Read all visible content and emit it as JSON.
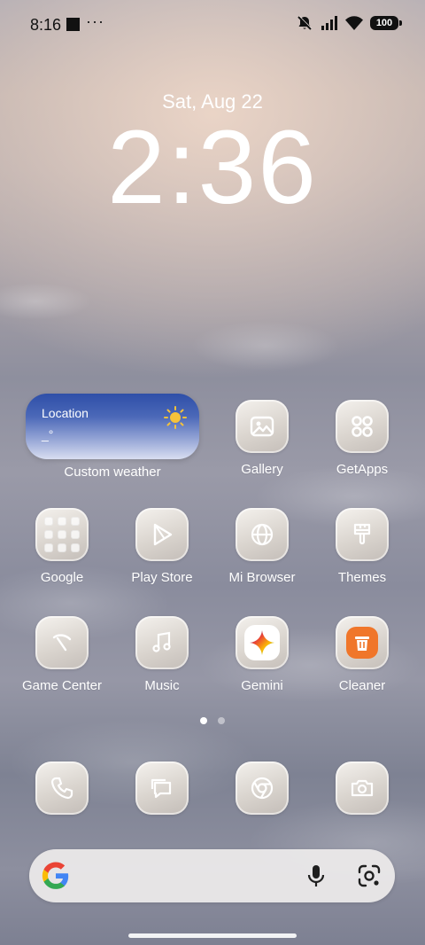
{
  "status_bar": {
    "time": "8:16",
    "overflow": "···",
    "battery": "100",
    "icons": [
      "square-notification-icon",
      "mute-icon",
      "signal-icon",
      "wifi-icon",
      "battery-icon"
    ]
  },
  "lock": {
    "date": "Sat, Aug 22",
    "time": "2:36"
  },
  "weather_widget": {
    "location": "Location",
    "temperature": "_°",
    "condition_icon": "sun-icon",
    "label": "Custom weather"
  },
  "apps": {
    "gallery": "Gallery",
    "getapps": "GetApps",
    "google": "Google",
    "play_store": "Play Store",
    "mi_browser": "Mi Browser",
    "themes": "Themes",
    "game_center": "Game Center",
    "music": "Music",
    "gemini": "Gemini",
    "cleaner": "Cleaner"
  },
  "dock": {
    "items": [
      "phone-icon",
      "messages-icon",
      "chrome-icon",
      "camera-icon"
    ]
  },
  "pages": {
    "count": 2,
    "active": 1
  },
  "search_bar": {
    "icons": [
      "google-g-icon",
      "microphone-icon",
      "google-lens-icon"
    ]
  },
  "colors": {
    "cleaner_orange": "#f0762a",
    "tile_bg": "#e6e0d8",
    "weather_blue": "#2e4fa8"
  }
}
